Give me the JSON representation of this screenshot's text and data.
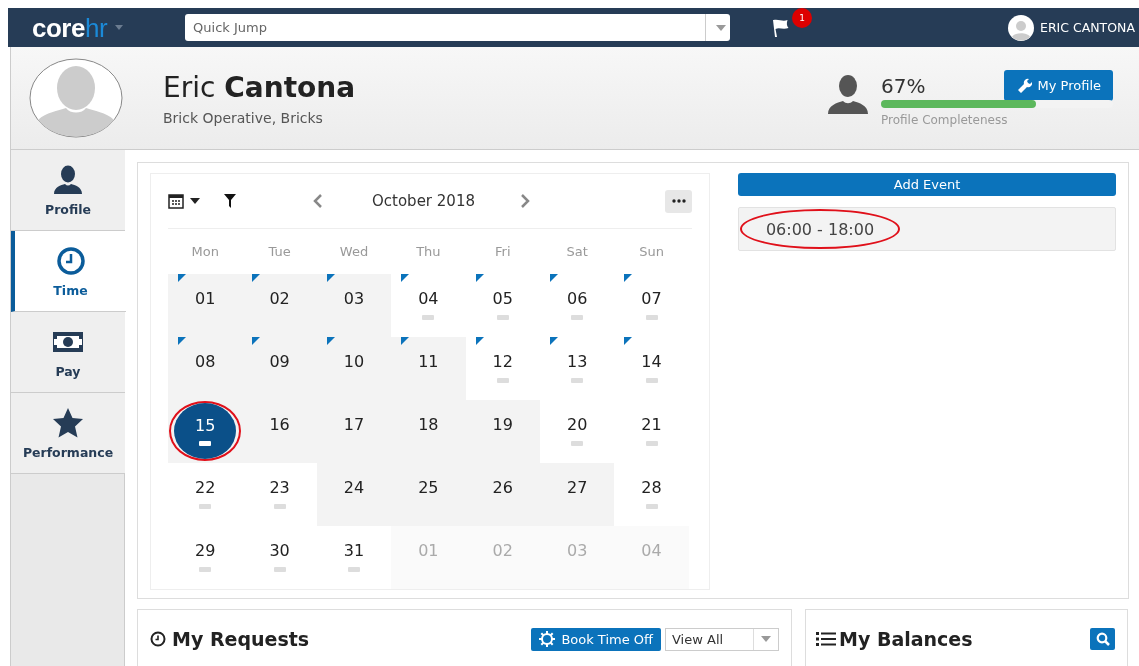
{
  "nav": {
    "logo": {
      "text": "core",
      "accent": "hr"
    },
    "search": {
      "placeholder": "Quick Jump"
    },
    "notifications": "1",
    "user": "ERIC CANTONA"
  },
  "profile": {
    "name": "Eric **Cantona**",
    "role": "Brick Operative, Bricks",
    "completeness": {
      "reading": "67%",
      "level": 0.67,
      "label": "Profile Completeness"
    },
    "button": "My Profile"
  },
  "sidebar": {
    "items": [
      {
        "label": "Profile",
        "kind": "person",
        "selected": false
      },
      {
        "label": "Time",
        "kind": "clock",
        "selected": true
      },
      {
        "label": "Pay",
        "kind": "money",
        "selected": false
      },
      {
        "label": "Performance",
        "kind": "star",
        "selected": false
      }
    ]
  },
  "calendar": {
    "month": "October 2018",
    "weekdays": [
      "Mon",
      "Tue",
      "Wed",
      "Thu",
      "Fri",
      "Sat",
      "Sun"
    ],
    "days": [
      {
        "label": "01",
        "shaded": true,
        "flag": true,
        "dash": false,
        "other_month": false,
        "selected": false,
        "circled": false
      },
      {
        "label": "02",
        "shaded": true,
        "flag": true,
        "dash": false,
        "other_month": false,
        "selected": false,
        "circled": false
      },
      {
        "label": "03",
        "shaded": true,
        "flag": true,
        "dash": false,
        "other_month": false,
        "selected": false,
        "circled": false
      },
      {
        "label": "04",
        "shaded": false,
        "flag": true,
        "dash": true,
        "other_month": false,
        "selected": false,
        "circled": false
      },
      {
        "label": "05",
        "shaded": false,
        "flag": true,
        "dash": true,
        "other_month": false,
        "selected": false,
        "circled": false
      },
      {
        "label": "06",
        "shaded": false,
        "flag": true,
        "dash": true,
        "other_month": false,
        "selected": false,
        "circled": false
      },
      {
        "label": "07",
        "shaded": false,
        "flag": true,
        "dash": true,
        "other_month": false,
        "selected": false,
        "circled": false
      },
      {
        "label": "08",
        "shaded": true,
        "flag": true,
        "dash": false,
        "other_month": false,
        "selected": false,
        "circled": false
      },
      {
        "label": "09",
        "shaded": true,
        "flag": true,
        "dash": false,
        "other_month": false,
        "selected": false,
        "circled": false
      },
      {
        "label": "10",
        "shaded": true,
        "flag": true,
        "dash": false,
        "other_month": false,
        "selected": false,
        "circled": false
      },
      {
        "label": "11",
        "shaded": true,
        "flag": true,
        "dash": false,
        "other_month": false,
        "selected": false,
        "circled": false
      },
      {
        "label": "12",
        "shaded": false,
        "flag": true,
        "dash": true,
        "other_month": false,
        "selected": false,
        "circled": false
      },
      {
        "label": "13",
        "shaded": false,
        "flag": true,
        "dash": true,
        "other_month": false,
        "selected": false,
        "circled": false
      },
      {
        "label": "14",
        "shaded": false,
        "flag": true,
        "dash": true,
        "other_month": false,
        "selected": false,
        "circled": false
      },
      {
        "label": "15",
        "shaded": true,
        "flag": false,
        "dash": true,
        "other_month": false,
        "selected": true,
        "circled": true
      },
      {
        "label": "16",
        "shaded": true,
        "flag": false,
        "dash": false,
        "other_month": false,
        "selected": false,
        "circled": false
      },
      {
        "label": "17",
        "shaded": true,
        "flag": false,
        "dash": false,
        "other_month": false,
        "selected": false,
        "circled": false
      },
      {
        "label": "18",
        "shaded": true,
        "flag": false,
        "dash": false,
        "other_month": false,
        "selected": false,
        "circled": false
      },
      {
        "label": "19",
        "shaded": true,
        "flag": false,
        "dash": false,
        "other_month": false,
        "selected": false,
        "circled": false
      },
      {
        "label": "20",
        "shaded": false,
        "flag": false,
        "dash": true,
        "other_month": false,
        "selected": false,
        "circled": false
      },
      {
        "label": "21",
        "shaded": false,
        "flag": false,
        "dash": true,
        "other_month": false,
        "selected": false,
        "circled": false
      },
      {
        "label": "22",
        "shaded": false,
        "flag": false,
        "dash": true,
        "other_month": false,
        "selected": false,
        "circled": false
      },
      {
        "label": "23",
        "shaded": false,
        "flag": false,
        "dash": true,
        "other_month": false,
        "selected": false,
        "circled": false
      },
      {
        "label": "24",
        "shaded": true,
        "flag": false,
        "dash": false,
        "other_month": false,
        "selected": false,
        "circled": false
      },
      {
        "label": "25",
        "shaded": true,
        "flag": false,
        "dash": false,
        "other_month": false,
        "selected": false,
        "circled": false
      },
      {
        "label": "26",
        "shaded": true,
        "flag": false,
        "dash": false,
        "other_month": false,
        "selected": false,
        "circled": false
      },
      {
        "label": "27",
        "shaded": true,
        "flag": false,
        "dash": false,
        "other_month": false,
        "selected": false,
        "circled": false
      },
      {
        "label": "28",
        "shaded": false,
        "flag": false,
        "dash": true,
        "other_month": false,
        "selected": false,
        "circled": false
      },
      {
        "label": "29",
        "shaded": false,
        "flag": false,
        "dash": true,
        "other_month": false,
        "selected": false,
        "circled": false
      },
      {
        "label": "30",
        "shaded": false,
        "flag": false,
        "dash": true,
        "other_month": false,
        "selected": false,
        "circled": false
      },
      {
        "label": "31",
        "shaded": false,
        "flag": false,
        "dash": true,
        "other_month": false,
        "selected": false,
        "circled": false
      },
      {
        "label": "01",
        "shaded": false,
        "flag": false,
        "dash": false,
        "other_month": true,
        "selected": false,
        "circled": false
      },
      {
        "label": "02",
        "shaded": false,
        "flag": false,
        "dash": false,
        "other_month": true,
        "selected": false,
        "circled": false
      },
      {
        "label": "03",
        "shaded": false,
        "flag": false,
        "dash": false,
        "other_month": true,
        "selected": false,
        "circled": false
      },
      {
        "label": "04",
        "shaded": false,
        "flag": false,
        "dash": false,
        "other_month": true,
        "selected": false,
        "circled": false
      }
    ]
  },
  "events": {
    "add_button": "Add Event",
    "items": [
      {
        "time": "06:00 - 18:00",
        "circled": true
      }
    ]
  },
  "requests": {
    "title": "My Requests",
    "book_button": "Book Time Off",
    "filter": "View All"
  },
  "balances": {
    "title": "My Balances"
  }
}
